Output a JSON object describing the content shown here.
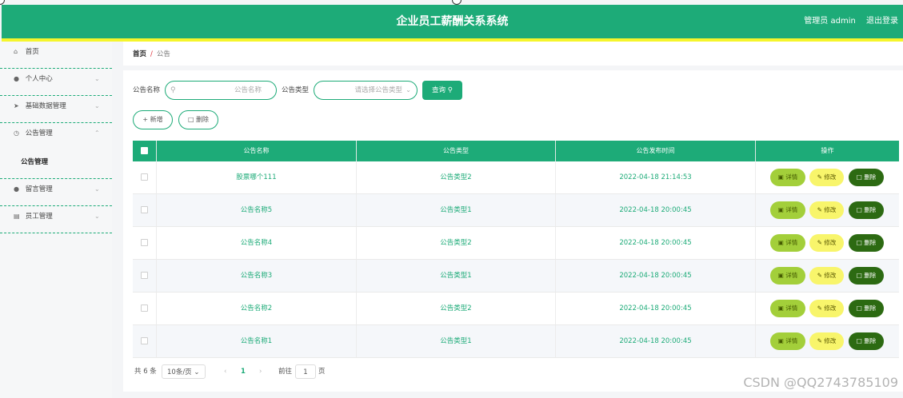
{
  "header": {
    "title": "企业员工薪酬关系系统",
    "user_label": "管理员 admin",
    "logout_label": "退出登录"
  },
  "sidebar": {
    "items": [
      {
        "label": "首页",
        "icon": "home-icon",
        "has_chevron": false
      },
      {
        "label": "个人中心",
        "icon": "user-icon",
        "has_chevron": true
      },
      {
        "label": "基础数据管理",
        "icon": "send-icon",
        "has_chevron": true
      },
      {
        "label": "公告管理",
        "icon": "clock-icon",
        "has_chevron": true,
        "expanded": true,
        "children": [
          {
            "label": "公告管理"
          }
        ]
      },
      {
        "label": "留言管理",
        "icon": "user-icon",
        "has_chevron": true
      },
      {
        "label": "员工管理",
        "icon": "chart-icon",
        "has_chevron": true
      }
    ]
  },
  "breadcrumb": {
    "home": "首页",
    "separator": "/",
    "current": "公告"
  },
  "filters": {
    "name_label": "公告名称",
    "name_placeholder": "公告名称",
    "type_label": "公告类型",
    "type_placeholder": "请选择公告类型",
    "search_button": "查询"
  },
  "actions": {
    "add_button": "新增",
    "delete_button": "删除"
  },
  "table": {
    "headers": {
      "name": "公告名称",
      "type": "公告类型",
      "time": "公告发布时间",
      "ops": "操作"
    },
    "rows": [
      {
        "name": "股票哪个111",
        "type": "公告类型2",
        "time": "2022-04-18 21:14:53"
      },
      {
        "name": "公告名称5",
        "type": "公告类型1",
        "time": "2022-04-18 20:00:45"
      },
      {
        "name": "公告名称4",
        "type": "公告类型2",
        "time": "2022-04-18 20:00:45"
      },
      {
        "name": "公告名称3",
        "type": "公告类型1",
        "time": "2022-04-18 20:00:45"
      },
      {
        "name": "公告名称2",
        "type": "公告类型2",
        "time": "2022-04-18 20:00:45"
      },
      {
        "name": "公告名称1",
        "type": "公告类型1",
        "time": "2022-04-18 20:00:45"
      }
    ],
    "row_buttons": {
      "detail": "详情",
      "edit": "修改",
      "delete": "删除"
    }
  },
  "pagination": {
    "total_text": "共 6 条",
    "page_size": "10条/页",
    "current_page": "1",
    "goto_label": "前往",
    "goto_value": "1",
    "page_unit": "页"
  },
  "watermark": "CSDN @QQ2743785109",
  "colors": {
    "primary": "#1dab78",
    "accent_stripe": "#f5f52c",
    "detail_btn": "#a3cf3a",
    "edit_btn": "#f8f56b",
    "delete_btn": "#2c6a12"
  }
}
